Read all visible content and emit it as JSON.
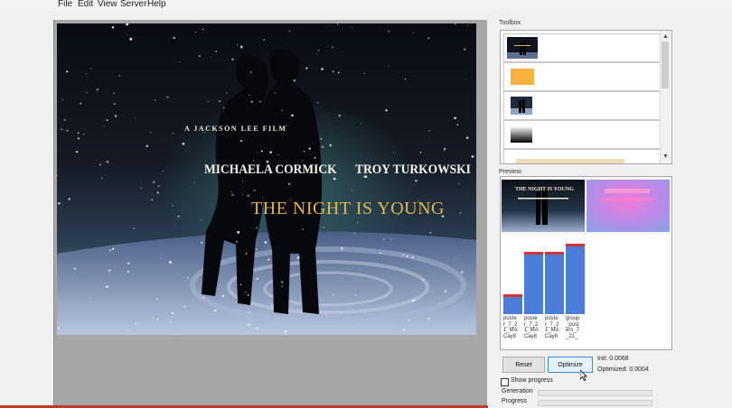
{
  "menu": {
    "items": [
      "File",
      "Edit",
      "View",
      "Server",
      "Help"
    ]
  },
  "poster": {
    "credit": "A JACKSON LEE FILM",
    "actor_left": "MICHAELA CORMICK",
    "actor_right": "TROY TURKOWSKI",
    "title": "THE NIGHT IS YOUNG"
  },
  "toolbox": {
    "label": "Toolbox",
    "items": [
      "poster-thumbnail",
      "orange-swatch",
      "couple-thumbnail",
      "gradient-swatch",
      "title-text-thumbnail"
    ]
  },
  "preview": {
    "label": "Preview",
    "mini_title": "THE NIGHT IS YOUNG"
  },
  "chart_data": {
    "type": "bar",
    "categories": [
      "poster_7_21_MACay8",
      "poster_7_21_MACay8",
      "poster_7_21_MACay8",
      "group_posters_7_21_"
    ],
    "category_labels": [
      [
        "poste",
        "r_7_2",
        "1_MA",
        "Cay8"
      ],
      [
        "poste",
        "r_7_2",
        "1_MA",
        "Cay8"
      ],
      [
        "poste",
        "r_7_2",
        "1_MA",
        "Cay8"
      ],
      [
        "group",
        "_post",
        "ers_7",
        "_21_"
      ]
    ],
    "values": [
      0.0015,
      0.0046,
      0.0046,
      0.0052
    ],
    "ylim": [
      0,
      0.0055
    ],
    "colors": {
      "bar": "#4a7ed8",
      "cap": "#d93030"
    },
    "grid": false,
    "title": "",
    "xlabel": "",
    "ylabel": ""
  },
  "controls": {
    "reset_label": "Reset",
    "optimize_label": "Optimize",
    "init_label": "Init: 0.0068",
    "optimized_label": "Optimized: 0.0004",
    "show_progress_label": "Show progress",
    "show_progress_checked": false,
    "generation_label": "Generation",
    "progress_label": "Progress",
    "generation_value": 0,
    "progress_value": 0
  }
}
